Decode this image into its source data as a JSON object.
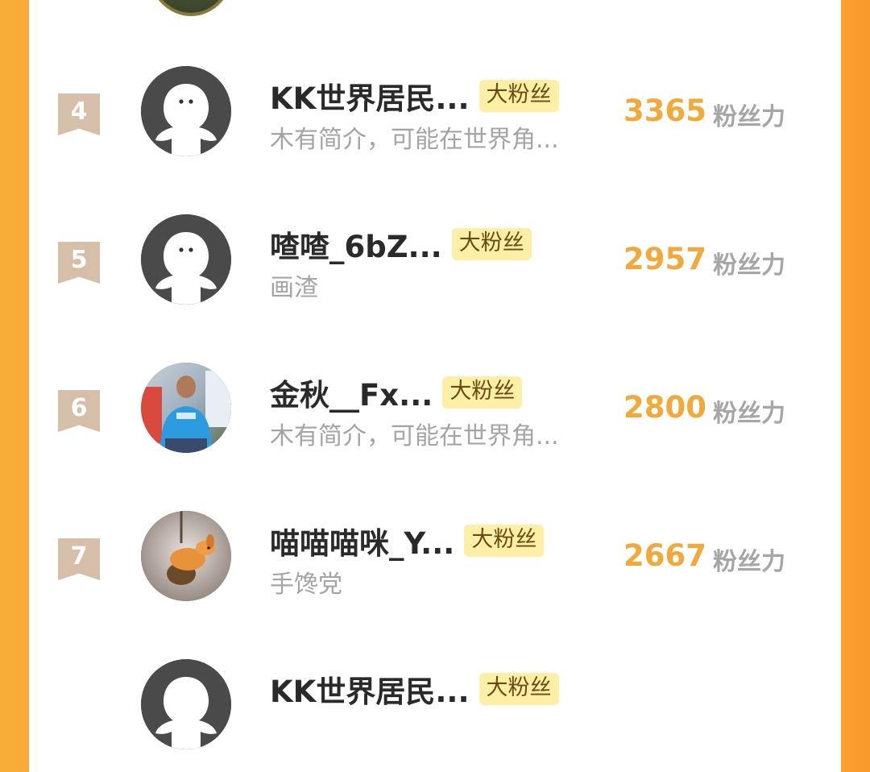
{
  "list": [
    {
      "rank": "4",
      "name": "KK世界居民...",
      "badge": "大粉丝",
      "bio": "木有简介，可能在世界角...",
      "score": "3365",
      "score_unit": "粉丝力",
      "avatar": "default-avatar"
    },
    {
      "rank": "5",
      "name": "喳喳_6bZ...",
      "badge": "大粉丝",
      "bio": "画渣",
      "score": "2957",
      "score_unit": "粉丝力",
      "avatar": "default-avatar"
    },
    {
      "rank": "6",
      "name": "金秋__Fx...",
      "badge": "大粉丝",
      "bio": "木有简介，可能在世界角...",
      "score": "2800",
      "score_unit": "粉丝力",
      "avatar": "photo-man-blue-shirt"
    },
    {
      "rank": "7",
      "name": "喵喵喵咪_Y...",
      "badge": "大粉丝",
      "bio": "手馋党",
      "score": "2667",
      "score_unit": "粉丝力",
      "avatar": "photo-toy-figure"
    },
    {
      "rank": "",
      "name": "KK世界居民...",
      "badge": "大粉丝",
      "bio": "",
      "score": "",
      "score_unit": "",
      "avatar": "default-avatar"
    }
  ],
  "colors": {
    "page_border": "#f9a93a",
    "rank_flag": "#d5bfa9",
    "score": "#f2a93a",
    "badge_bg": "#fdf0a6",
    "muted_text": "#a4a4a4"
  }
}
